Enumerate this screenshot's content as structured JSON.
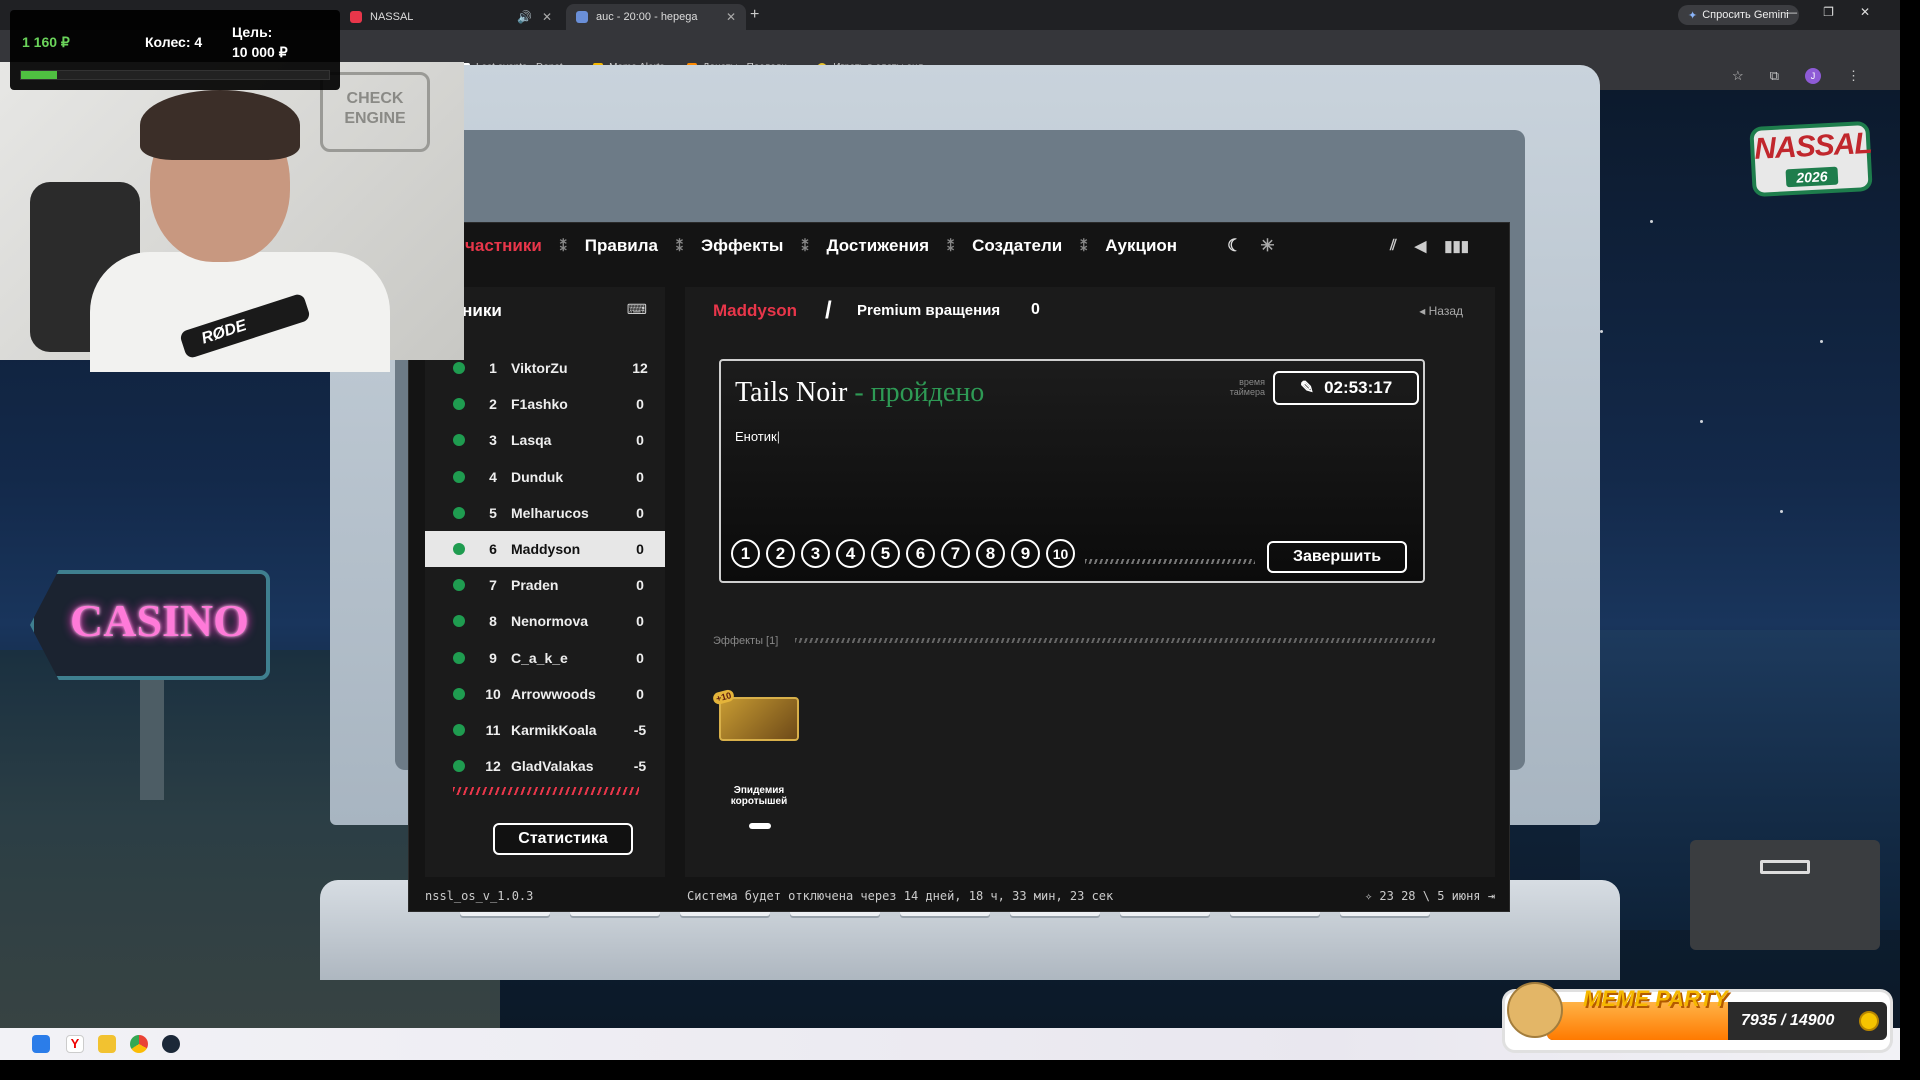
{
  "browser": {
    "tabs": [
      {
        "label": "NASSAL"
      },
      {
        "label": "auc - 20:00 - hepega"
      }
    ],
    "gemini_label": "Спросить Gemini",
    "bookmarks": [
      "Last events - Donat...",
      "Meme Alerts",
      "Донаты - Последн...",
      "Играть в слоты онл..."
    ],
    "avatar_letter": "J"
  },
  "donation": {
    "amount": "1 160 ₽",
    "wheels": "Колес: 4",
    "goal_label": "Цель:",
    "goal_value": "10 000 ₽",
    "progress": 0.116
  },
  "webcam": {
    "wall_sign": "CHECK ENGINE",
    "mic_brand": "RØDE"
  },
  "casino_sign": "CASINO",
  "nassal_logo": {
    "name": "NASSAL",
    "year": "2026"
  },
  "os": {
    "nav": [
      "частники",
      "Правила",
      "Эффекты",
      "Достижения",
      "Создатели",
      "Аукцион"
    ],
    "nav_active": 0,
    "participants_title": "частники",
    "participants": [
      {
        "rank": "1",
        "name": "ViktorZu",
        "score": "12"
      },
      {
        "rank": "2",
        "name": "F1ashko",
        "score": "0"
      },
      {
        "rank": "3",
        "name": "Lasqa",
        "score": "0"
      },
      {
        "rank": "4",
        "name": "Dunduk",
        "score": "0"
      },
      {
        "rank": "5",
        "name": "Melharucos",
        "score": "0"
      },
      {
        "rank": "6",
        "name": "Maddyson",
        "score": "0"
      },
      {
        "rank": "7",
        "name": "Praden",
        "score": "0"
      },
      {
        "rank": "8",
        "name": "Nenormova",
        "score": "0"
      },
      {
        "rank": "9",
        "name": "C_a_k_e",
        "score": "0"
      },
      {
        "rank": "10",
        "name": "Arrowwoods",
        "score": "0"
      },
      {
        "rank": "11",
        "name": "KarmikKoala",
        "score": "-5"
      },
      {
        "rank": "12",
        "name": "GladValakas",
        "score": "-5"
      }
    ],
    "selected_participant": 5,
    "stats_button": "Статистика",
    "user": "Maddyson",
    "premium_label": "Premium вращения",
    "premium_count": "0",
    "back_label": "Назад",
    "game": {
      "title": "Tails Noir",
      "status": "- пройдено",
      "timer_label_1": "время",
      "timer_label_2": "таймера",
      "timer": "02:53:17",
      "comment": "Енотик",
      "ratings": [
        "1",
        "2",
        "3",
        "4",
        "5",
        "6",
        "7",
        "8",
        "9",
        "10"
      ],
      "finish_button": "Завершить"
    },
    "effects_label": "Эффекты [1]",
    "effect": {
      "badge": "+10",
      "name": "Эпидемия коротышей"
    },
    "status": {
      "version": "nssl_os_v_1.0.3",
      "message": "Система будет отключена через 14 дней, 18 ч, 33 мин, 23 сек",
      "date": "23 28 \\ 5 июня"
    }
  },
  "meme_party": {
    "title": "MEME PARTY",
    "count": "7935 / 14900",
    "progress": 0.533
  },
  "colors": {
    "accent": "#e8364a",
    "status_green": "#1f9c50",
    "passed_green": "#2e9a55"
  }
}
